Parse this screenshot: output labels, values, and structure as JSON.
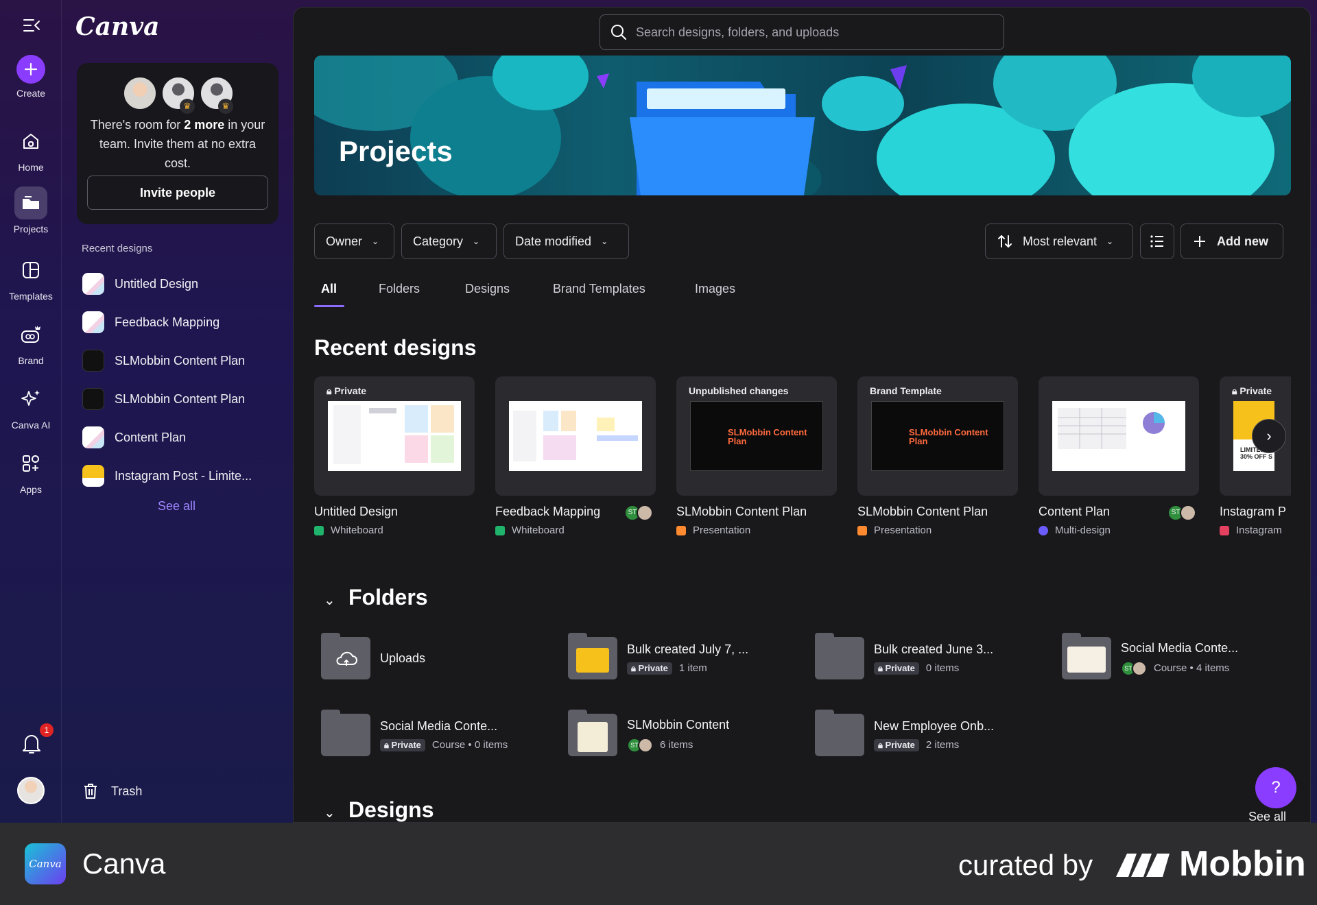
{
  "rail": {
    "create": "Create",
    "home": "Home",
    "projects": "Projects",
    "templates": "Templates",
    "brand": "Brand",
    "canva_ai": "Canva AI",
    "apps": "Apps",
    "notif_count": "1"
  },
  "panel": {
    "logo": "Canva",
    "invite_text_a": "There's room for ",
    "invite_text_bold": "2 more",
    "invite_text_b": " in your team. Invite them at no extra cost.",
    "invite_button": "Invite people",
    "recent_title": "Recent designs",
    "recent_items": [
      {
        "label": "Untitled Design"
      },
      {
        "label": "Feedback Mapping"
      },
      {
        "label": "SLMobbin Content Plan"
      },
      {
        "label": "SLMobbin Content Plan"
      },
      {
        "label": "Content Plan"
      },
      {
        "label": "Instagram Post - Limite..."
      }
    ],
    "see_all": "See all",
    "trash": "Trash"
  },
  "main": {
    "search_placeholder": "Search designs, folders, and uploads",
    "hero_title": "Projects",
    "filters": {
      "owner": "Owner",
      "category": "Category",
      "date": "Date modified",
      "sort": "Most relevant",
      "add_new": "Add new"
    },
    "tabs": [
      "All",
      "Folders",
      "Designs",
      "Brand Templates",
      "Images"
    ],
    "recent_heading": "Recent designs",
    "cards": [
      {
        "tag": "Private",
        "name": "Untitled Design",
        "type": "Whiteboard",
        "color": "#1fb36b"
      },
      {
        "tag": "",
        "name": "Feedback Mapping",
        "type": "Whiteboard",
        "color": "#1fb36b"
      },
      {
        "tag": "Unpublished changes",
        "name": "SLMobbin Content Plan",
        "type": "Presentation",
        "color": "#ff8a30"
      },
      {
        "tag": "Brand Template",
        "name": "SLMobbin Content Plan",
        "type": "Presentation",
        "color": "#ff8a30"
      },
      {
        "tag": "",
        "name": "Content Plan",
        "type": "Multi-design",
        "color": "#6a5cff"
      },
      {
        "tag": "Private",
        "name": "Instagram P",
        "type": "Instagram",
        "color": "#e4405f"
      }
    ],
    "card_brand_text": "SLMobbin Content Plan",
    "card_insta_text": "LIMITED-T 30% OFF S",
    "collab_initials": "ST",
    "folders_heading": "Folders",
    "folders": [
      {
        "name": "Uploads",
        "private": "",
        "meta": ""
      },
      {
        "name": "Bulk created July 7, ...",
        "private": "Private",
        "meta": "1 item"
      },
      {
        "name": "Bulk created June 3...",
        "private": "Private",
        "meta": "0 items"
      },
      {
        "name": "Social Media Conte...",
        "private": "",
        "meta": "Course • 4 items"
      },
      {
        "name": "Social Media Conte...",
        "private": "Private",
        "meta": "Course • 0 items"
      },
      {
        "name": "SLMobbin Content",
        "private": "",
        "meta": "6 items"
      },
      {
        "name": "New Employee Onb...",
        "private": "Private",
        "meta": "2 items"
      }
    ],
    "designs_heading": "Designs",
    "see_all": "See all",
    "help": "?"
  },
  "footer": {
    "logo_text": "Canva",
    "app_name": "Canva",
    "curated_by": "curated by",
    "mobbin": "Mobbin"
  },
  "colors": {
    "accent": "#8b3dff",
    "underline": "#8b6cff",
    "see_all_link": "#9f86ff"
  }
}
